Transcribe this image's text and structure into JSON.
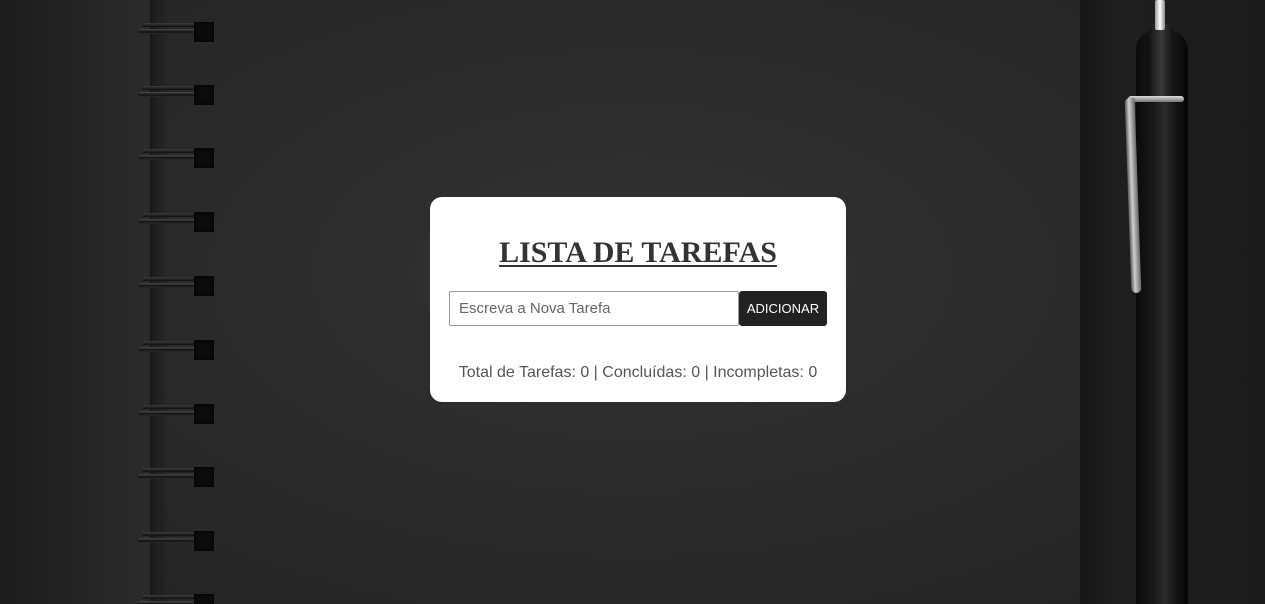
{
  "app": {
    "title": "LISTA DE TAREFAS"
  },
  "form": {
    "input_value": "",
    "input_placeholder": "Escreva a Nova Tarefa",
    "add_label": "ADICIONAR"
  },
  "stats": {
    "text": "Total de Tarefas: 0 | Concluídas: 0 | Incompletas: 0",
    "total": 0,
    "completed": 0,
    "incomplete": 0
  },
  "tasks": [],
  "colors": {
    "card_background": "#ffffff",
    "button_background": "#222222",
    "page_background": "#2a2a2a"
  }
}
